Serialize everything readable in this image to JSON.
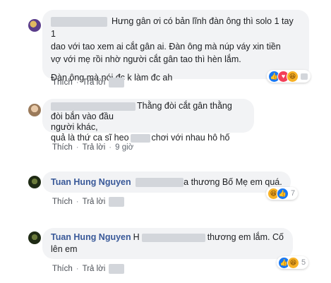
{
  "comments": [
    {
      "author": "",
      "lines": [
        "Hưng gân ơi có bản lĩnh đàn ông thì solo 1 tay 1",
        "dao với tao xem ai cắt gân ai. Đàn ông mà núp váy xin tiền",
        "vợ với mẹ rồi nhờ người cắt gân tao thì hèn lắm.",
        "Đàn ông mà nói đc k làm đc ah"
      ],
      "reactions": {
        "icons": [
          "like-icon",
          "love-icon",
          "haha-icon"
        ],
        "count": ""
      },
      "actions": {
        "like": "Thích",
        "reply": "Trả lời",
        "time": ""
      }
    },
    {
      "author": "",
      "lines": [
        "Thằng đòi cắt gân thằng đòi bắn vào đầu",
        "người khác,",
        "quả là thứ ca sĩ heo",
        "chơi với nhau hô hố"
      ],
      "actions": {
        "like": "Thích",
        "reply": "Trả lời",
        "time": "9 giờ"
      }
    },
    {
      "author": "Tuan Hung Nguyen",
      "lines": [
        "a thương Bố Mẹ em quá."
      ],
      "reactions": {
        "icons": [
          "haha-icon",
          "like-icon"
        ],
        "count": "7"
      },
      "actions": {
        "like": "Thích",
        "reply": "Trả lời",
        "time": ""
      }
    },
    {
      "author": "Tuan Hung Nguyen",
      "lines": [
        "H",
        "thương em lắm. Cố",
        "lên em"
      ],
      "reactions": {
        "icons": [
          "like-icon",
          "haha-icon"
        ],
        "count": "5"
      },
      "actions": {
        "like": "Thích",
        "reply": "Trả lời",
        "time": ""
      }
    }
  ],
  "separator": "·"
}
